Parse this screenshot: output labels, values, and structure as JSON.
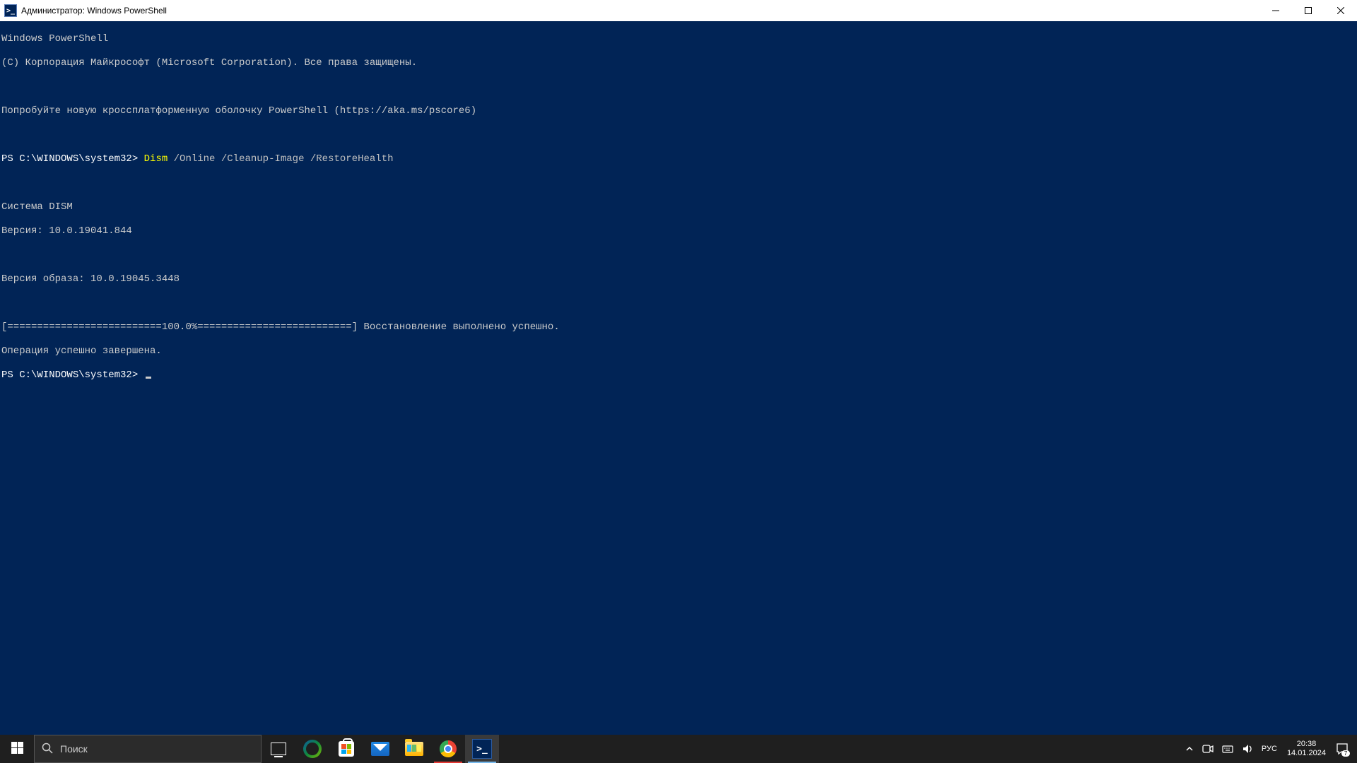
{
  "window": {
    "title": "Администратор: Windows PowerShell",
    "icon_glyph": ">_"
  },
  "terminal": {
    "line1": "Windows PowerShell",
    "line2": "(C) Корпорация Майкрософт (Microsoft Corporation). Все права защищены.",
    "line3": "Попробуйте новую кроссплатформенную оболочку PowerShell (https://aka.ms/pscore6)",
    "prompt1": "PS C:\\WINDOWS\\system32> ",
    "cmd_name": "Dism",
    "cmd_args": " /Online /Cleanup-Image /RestoreHealth",
    "line5": "Cистема DISM",
    "line6": "Версия: 10.0.19041.844",
    "line7": "Версия образа: 10.0.19045.3448",
    "progress": "[==========================100.0%==========================] Восстановление выполнено успешно.",
    "line9": "Операция успешно завершена.",
    "prompt2": "PS C:\\WINDOWS\\system32> "
  },
  "taskbar": {
    "search_placeholder": "Поиск",
    "lang": "РУС",
    "time": "20:38",
    "date": "14.01.2024",
    "notif_count": "7"
  }
}
